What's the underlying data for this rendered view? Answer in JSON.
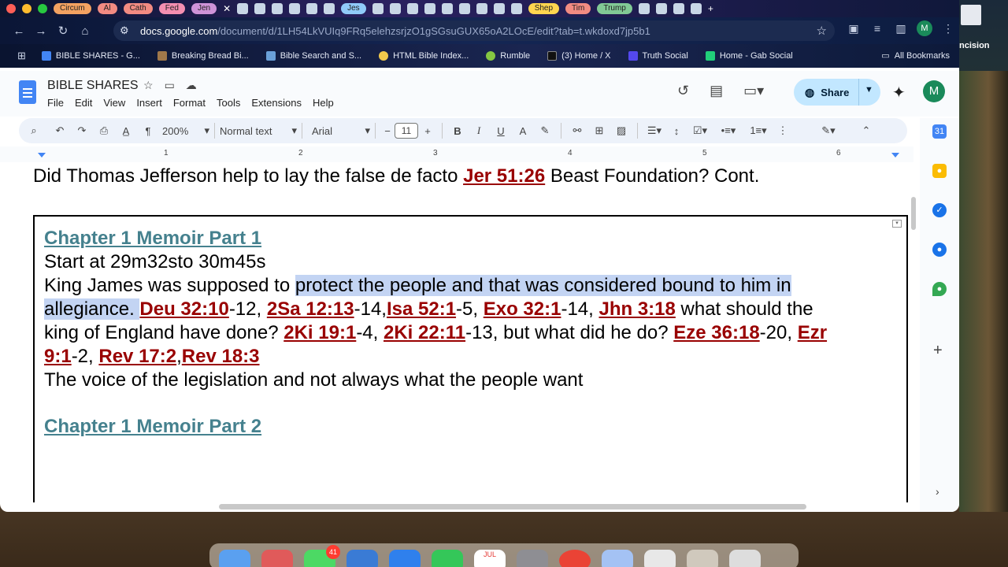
{
  "tabs": [
    "Circum",
    "Al",
    "Cath",
    "Fed",
    "Jen",
    "Jes",
    "Shep",
    "Tim",
    "Trump"
  ],
  "address": {
    "domain": "docs.google.com",
    "path": "/document/d/1LH54LkVUIq9FRq5elehzsrjzO1gSGsuGUX65oA2LOcE/edit?tab=t.wkdoxd7jp5b1"
  },
  "profile_initial": "M",
  "bookmarks": [
    {
      "label": "BIBLE SHARES - G...",
      "color": "#4285f4"
    },
    {
      "label": "Breaking Bread Bi...",
      "color": "#a0784a"
    },
    {
      "label": "Bible Search and S...",
      "color": "#6aa0d8"
    },
    {
      "label": "HTML Bible Index...",
      "color": "#f2c94c"
    },
    {
      "label": "Rumble",
      "color": "#85c742"
    },
    {
      "label": "(3) Home / X",
      "color": "#111111"
    },
    {
      "label": "Truth Social",
      "color": "#5448ee"
    },
    {
      "label": "Home - Gab Social",
      "color": "#21cf7a"
    }
  ],
  "all_bookmarks": "All Bookmarks",
  "doc": {
    "title": "BIBLE SHARES",
    "menu": [
      "File",
      "Edit",
      "View",
      "Insert",
      "Format",
      "Tools",
      "Extensions",
      "Help"
    ],
    "share_label": "Share",
    "user_initial": "M"
  },
  "format": {
    "zoom": "200%",
    "style": "Normal text",
    "font": "Arial",
    "size": "11"
  },
  "ruler": [
    "1",
    "2",
    "3",
    "4",
    "5",
    "6"
  ],
  "content": {
    "heading_pre": "Did Thomas Jefferson help to lay the false de facto ",
    "heading_ref": "Jer 51:26",
    "heading_post": " Beast Foundation? Cont.",
    "chapter1": "Chapter 1 Memoir Part 1",
    "line_start": "Start at 29m32sto 30m45s",
    "l3_a": "King James was supposed to ",
    "l3_b": "protect the people and that was considered bound to him in",
    "l4_a": "allegiance. ",
    "r1": "Deu 32:10",
    "t1": "-12, ",
    "r2": "2Sa 12:13",
    "t2": "-14,",
    "r3": "Isa 52:1",
    "t3": "-5, ",
    "r4": "Exo 32:1",
    "t4": "-14, ",
    "r5": "Jhn 3:18",
    "t5": " what should the",
    "l5_a": "king of England have done? ",
    "r6": "2Ki 19:1",
    "t6": "-4, ",
    "r7": "2Ki 22:11",
    "t7": "-13, but what did he do? ",
    "r8": "Eze 36:18",
    "t8": "-20, ",
    "r9": "Ezr",
    "r9b": "9:1",
    "t9": "-2, ",
    "r10": "Rev 17:2",
    "t10": ",",
    "r11": "Rev 18:3",
    "line_voice": "The voice of the legislation and not always what the people want",
    "chapter2": "Chapter 1 Memoir Part 2"
  },
  "edge_text": "ncision",
  "dock_badge": "41",
  "dock_calendar": "JUL"
}
